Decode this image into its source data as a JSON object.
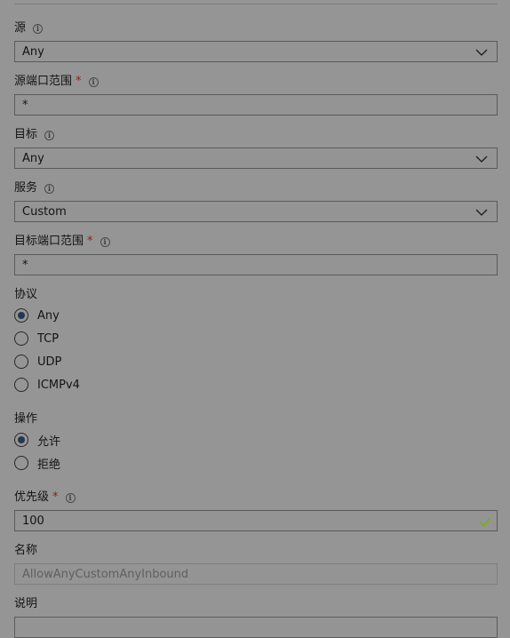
{
  "fields": {
    "source": {
      "label": "源",
      "value": "Any"
    },
    "source_port": {
      "label": "源端口范围",
      "required_mark": "*",
      "value": "*"
    },
    "destination": {
      "label": "目标",
      "value": "Any"
    },
    "service": {
      "label": "服务",
      "value": "Custom"
    },
    "dest_port": {
      "label": "目标端口范围",
      "required_mark": "*",
      "value": "*"
    },
    "protocol": {
      "label": "协议",
      "options": [
        "Any",
        "TCP",
        "UDP",
        "ICMPv4"
      ],
      "selected": "Any"
    },
    "action": {
      "label": "操作",
      "options": [
        "允许",
        "拒绝"
      ],
      "selected": "允许"
    },
    "priority": {
      "label": "优先级",
      "required_mark": "*",
      "value": "100"
    },
    "name": {
      "label": "名称",
      "value": "AllowAnyCustomAnyInbound"
    },
    "description": {
      "label": "说明"
    }
  },
  "icons": {
    "info": "info-icon",
    "dropdown": "chevron-down-icon",
    "valid": "checkmark-icon"
  },
  "colors": {
    "background": "#959595",
    "required": "#8a1f1f",
    "valid_check": "#6bb700",
    "radio_selected": "#24374f"
  }
}
